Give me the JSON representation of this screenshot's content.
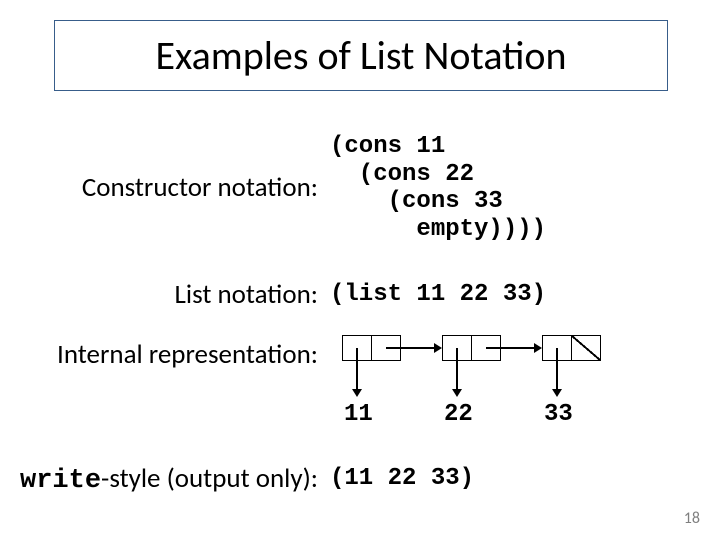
{
  "title": "Examples of List Notation",
  "rows": {
    "constructor": {
      "label": "Constructor notation:",
      "code": "(cons 11\n  (cons 22\n    (cons 33\n      empty))))"
    },
    "list": {
      "label": "List notation:",
      "code": "(list 11 22 33)"
    },
    "internal": {
      "label": "Internal representation:"
    },
    "write": {
      "label_prefix": "write",
      "label_suffix": "-style (output only):",
      "code": "(11 22 33)"
    }
  },
  "diagram": {
    "values": [
      "11",
      "22",
      "33"
    ]
  },
  "page_number": "18"
}
